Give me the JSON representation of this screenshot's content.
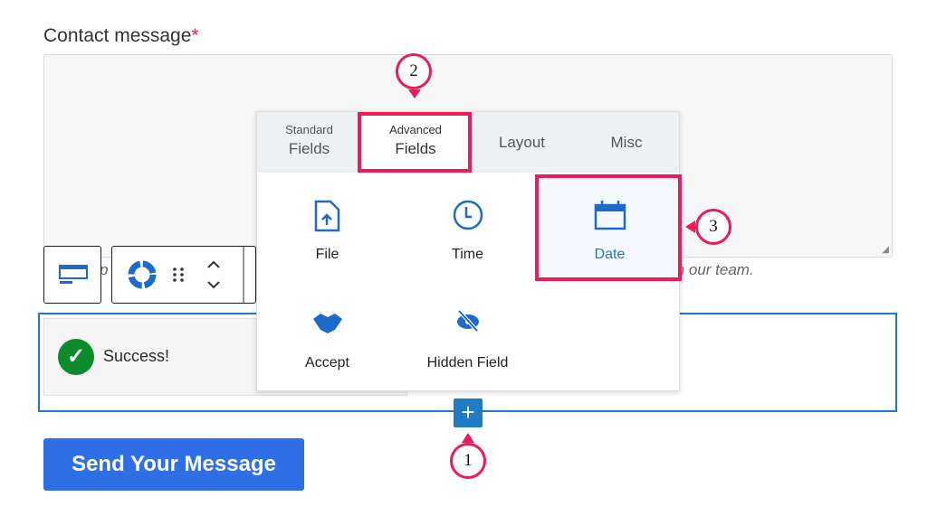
{
  "field": {
    "label": "Contact message",
    "required_mark": "*",
    "help_left": "p",
    "help_right": "m our team."
  },
  "notice": {
    "text": "Success!"
  },
  "submit": {
    "label": "Send Your Message"
  },
  "inserter": {
    "tabs": [
      {
        "small": "Standard",
        "big": "Fields"
      },
      {
        "small": "Advanced",
        "big": "Fields"
      },
      {
        "big": "Layout"
      },
      {
        "big": "Misc"
      }
    ],
    "active_tab": "Advanced Fields",
    "items": [
      {
        "label": "File",
        "icon": "file-upload-icon"
      },
      {
        "label": "Time",
        "icon": "clock-icon"
      },
      {
        "label": "Date",
        "icon": "calendar-icon"
      },
      {
        "label": "Accept",
        "icon": "handshake-icon"
      },
      {
        "label": "Hidden Field",
        "icon": "eye-slash-icon"
      }
    ],
    "selected": "Date"
  },
  "callouts": [
    "1",
    "2",
    "3"
  ],
  "colors": {
    "accent": "#1e7bc4",
    "highlight": "#ef1a58",
    "button": "#2f6fe6",
    "success": "#0e8a2e"
  }
}
